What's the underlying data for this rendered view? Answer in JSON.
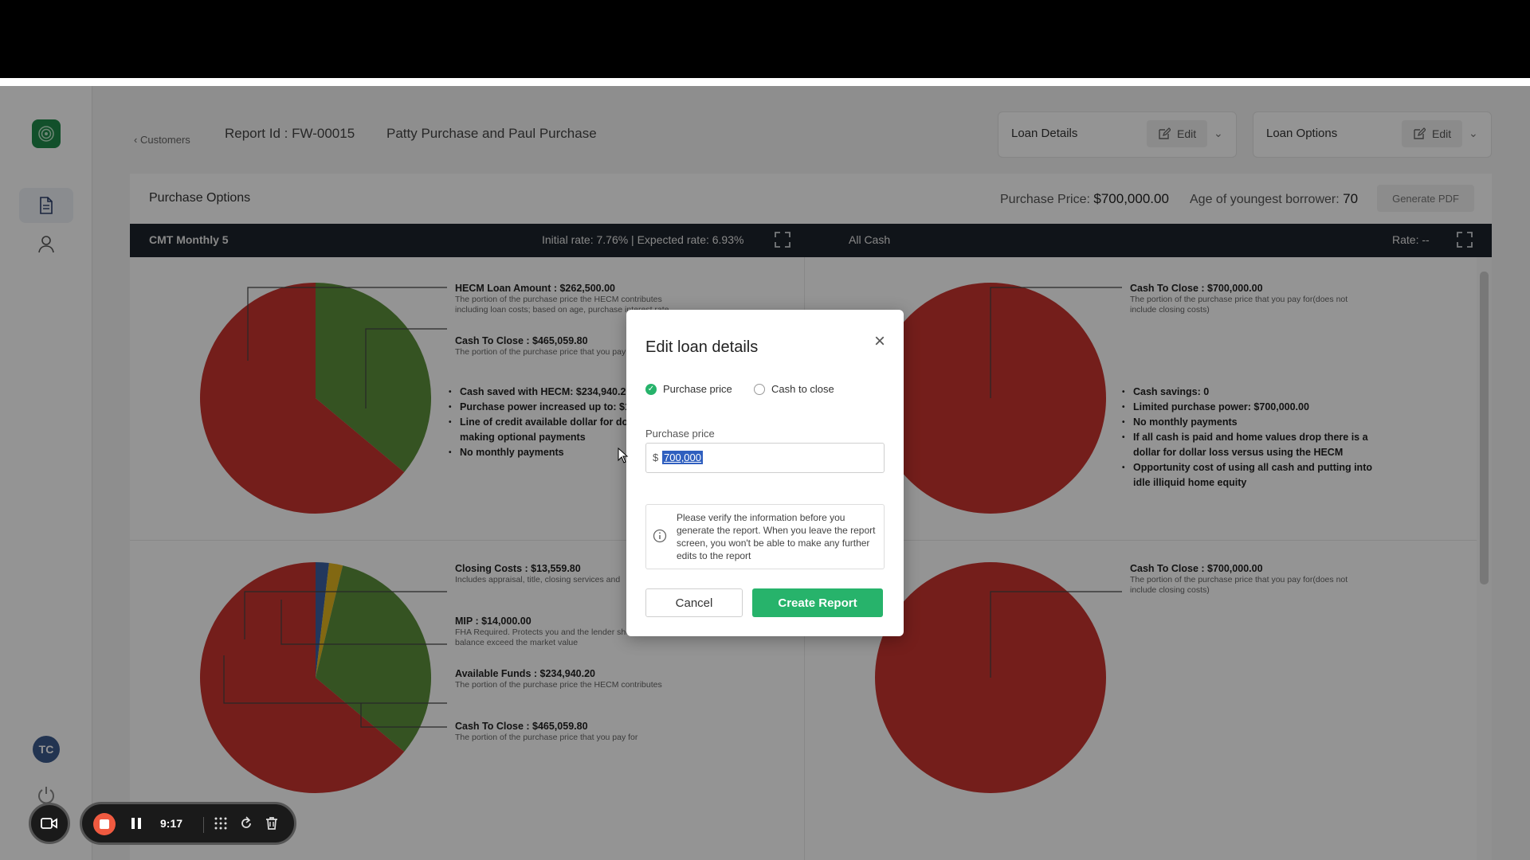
{
  "header": {
    "back_label": "Customers",
    "report_id": "Report Id : FW-00015",
    "borrowers": "Patty Purchase  and  Paul Purchase",
    "loan_details": {
      "label": "Loan Details",
      "edit_label": "Edit"
    },
    "loan_options": {
      "label": "Loan Options",
      "edit_label": "Edit"
    }
  },
  "sidebar": {
    "items": [
      {
        "name": "report",
        "icon": "document-icon",
        "active": true
      },
      {
        "name": "user",
        "icon": "user-icon",
        "active": false
      }
    ],
    "avatar_initials": "TC"
  },
  "panel": {
    "title": "Purchase Options",
    "purchase_price_label": "Purchase Price:",
    "purchase_price_value": "$700,000.00",
    "age_label": "Age of youngest borrower:",
    "age_value": "70",
    "generate_pdf": "Generate PDF"
  },
  "option_bar": {
    "left_name": "CMT Monthly 5",
    "left_rates": "Initial rate: 7.76% | Expected rate: 6.93%",
    "right_name": "All Cash",
    "right_rate": "Rate: --"
  },
  "charts": {
    "hecm_top": {
      "slices": [
        {
          "label": "HECM Loan Amount : $262,500.00",
          "desc": "The portion of the purchase price the HECM contributes including loan costs; based on age, purchase interest rate",
          "value": 262500,
          "color": "#5c8f3c"
        },
        {
          "label": "Cash To Close : $465,059.80",
          "desc": "The portion of the purchase price that you pay for",
          "value": 465059.8,
          "color": "#c8342f"
        }
      ],
      "bullets": [
        "Cash saved with HECM: $234,940.20",
        "Purchase power increased up to: $1",
        "Line of credit available dollar for dol making optional payments",
        "No monthly payments"
      ]
    },
    "hecm_bottom": {
      "slices": [
        {
          "label": "Closing Costs : $13,559.80",
          "desc": "Includes appraisal, title, closing services and",
          "value": 13559.8,
          "color": "#3b5fa0"
        },
        {
          "label": "MIP : $14,000.00",
          "desc": "FHA Required. Protects you and the lender should the loan balance exceed the market value",
          "value": 14000,
          "color": "#e0b420"
        },
        {
          "label": "Available Funds : $234,940.20",
          "desc": "The portion of the purchase price the HECM contributes",
          "value": 234940.2,
          "color": "#5c8f3c"
        },
        {
          "label": "Cash To Close : $465,059.80",
          "desc": "The portion of the purchase price that you pay for",
          "value": 465059.8,
          "color": "#c8342f"
        }
      ]
    },
    "cash_top": {
      "slices": [
        {
          "label": "Cash To Close : $700,000.00",
          "desc": "The portion of the purchase price that you pay for(does not include closing costs)",
          "value": 700000,
          "color": "#c8342f"
        }
      ],
      "bullets": [
        "Cash savings: 0",
        "Limited purchase power: $700,000.00",
        "No monthly payments",
        "If all cash is paid and home values drop there is a dollar for dollar loss versus using the HECM",
        "Opportunity cost of using all cash and putting into idle illiquid home equity"
      ]
    },
    "cash_bottom": {
      "slices": [
        {
          "label": "Cash To Close : $700,000.00",
          "desc": "The portion of the purchase price that you pay for(does not include closing costs)",
          "value": 700000,
          "color": "#c8342f"
        }
      ]
    }
  },
  "modal": {
    "title": "Edit loan details",
    "close_icon": "×",
    "radio_purchase": "Purchase price",
    "radio_cash": "Cash to close",
    "selected": "purchase_price",
    "field_label": "Purchase price",
    "currency": "$",
    "field_value": "700,000",
    "info_text": "Please verify the information before you generate the report. When you leave the report screen, you won't be able to make any further edits to the report",
    "cancel": "Cancel",
    "create": "Create Report"
  },
  "recorder": {
    "time": "9:17"
  }
}
